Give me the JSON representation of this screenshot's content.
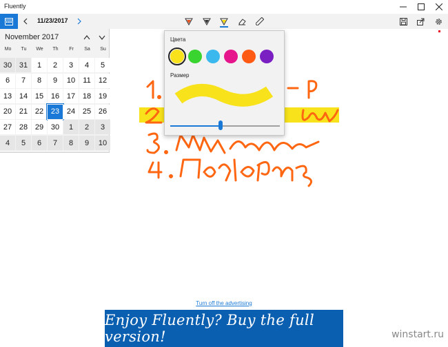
{
  "titlebar": {
    "title": "Fluently"
  },
  "toolbar": {
    "date": "11/23/2017",
    "tools": [
      {
        "icon": "pen-tool-icon",
        "color": "#e84d1a"
      },
      {
        "icon": "pencil-tool-icon",
        "color": "#333333"
      },
      {
        "icon": "highlighter-tool-icon",
        "color": "#f7d800"
      },
      {
        "icon": "eraser-icon",
        "color": "#333333"
      },
      {
        "icon": "ruler-icon",
        "color": "#333333"
      }
    ]
  },
  "calendar": {
    "month": "November 2017",
    "weekdays": [
      "Mo",
      "Tu",
      "We",
      "Th",
      "Fr",
      "Sa",
      "Su"
    ],
    "weeks": [
      [
        "30",
        "31",
        "1",
        "2",
        "3",
        "4",
        "5"
      ],
      [
        "6",
        "7",
        "8",
        "9",
        "10",
        "11",
        "12"
      ],
      [
        "13",
        "14",
        "15",
        "16",
        "17",
        "18",
        "19"
      ],
      [
        "20",
        "21",
        "22",
        "23",
        "24",
        "25",
        "26"
      ],
      [
        "27",
        "28",
        "29",
        "30",
        "1",
        "2",
        "3"
      ],
      [
        "4",
        "5",
        "6",
        "7",
        "8",
        "9",
        "10"
      ]
    ],
    "selected": "23"
  },
  "popup": {
    "colors_label": "Цвета",
    "size_label": "Размер",
    "swatches": [
      "#f7e21b",
      "#3ad431",
      "#3bb9ef",
      "#e6158c",
      "#ff5a14",
      "#7a1fc2"
    ],
    "selected_swatch": 0,
    "size_value": 0.46
  },
  "handwriting": {
    "lines": [
      "1. Купить хлеб - Р",
      "2. Позвонить маме",
      "3. Шпаргалка",
      "4. Подарки"
    ],
    "ink_color": "#ff6611",
    "highlight_color": "#f7e21b"
  },
  "ad": {
    "link_text": "Turn off the advertising",
    "banner_text": "Enjoy Fluently? Buy the full version!"
  },
  "watermark": "winstart.ru"
}
